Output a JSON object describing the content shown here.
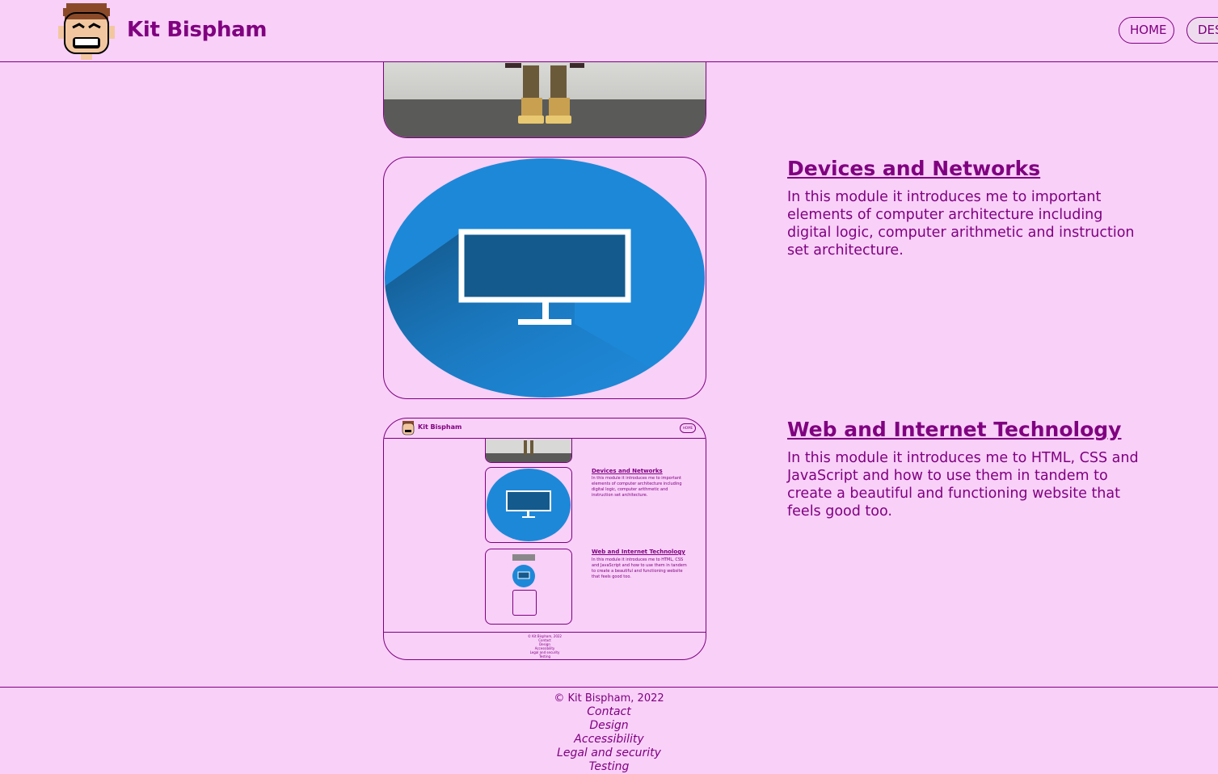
{
  "header": {
    "site_title": "Kit Bispham",
    "nav": [
      {
        "label": "HOME"
      },
      {
        "label": "DESIGN"
      }
    ]
  },
  "modules": [
    {
      "title": "Devices and Networks",
      "description": "In this module it introduces me to important elements of computer architecture including digital logic, computer arithmetic and instruction set architecture."
    },
    {
      "title": "Web and Internet Technology",
      "description": "In this module it introduces me to HTML, CSS and JavaScript and how to use them in tandem to create a beautiful and functioning website that feels good too."
    }
  ],
  "footer": {
    "copyright": "© Kit Bispham, 2022",
    "links": [
      "Contact",
      "Design",
      "Accessibility",
      "Legal and security",
      "Testing"
    ]
  },
  "colors": {
    "background": "#f8d0f8",
    "accent": "#800080",
    "monitor_blue": "#1e88d8"
  }
}
